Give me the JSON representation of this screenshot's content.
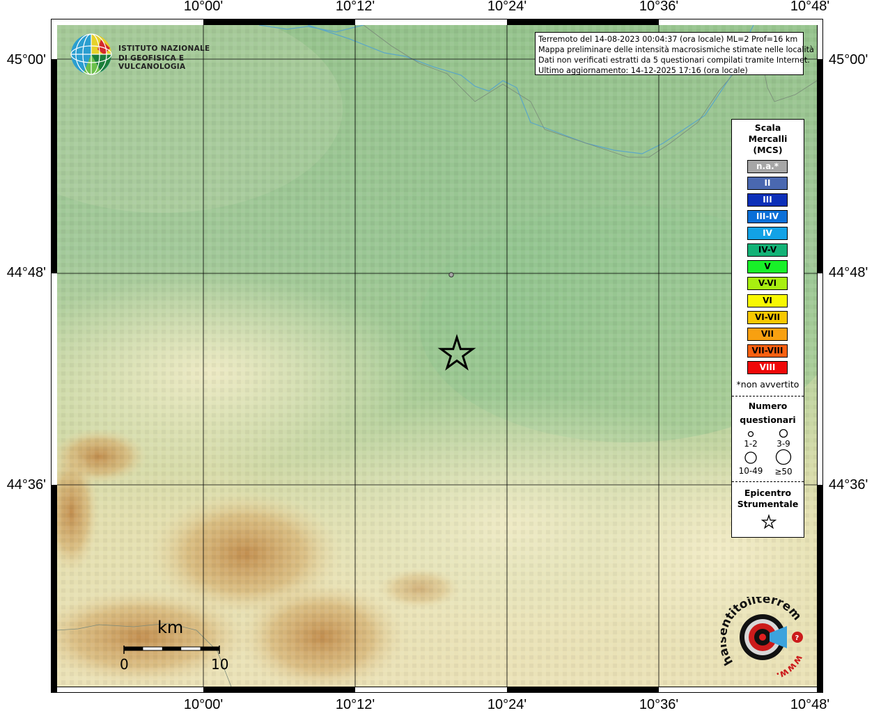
{
  "map": {
    "lon_labels": [
      "10°00'",
      "10°12'",
      "10°24'",
      "10°36'",
      "10°48'"
    ],
    "lat_labels": [
      "45°00'",
      "44°48'",
      "44°36'"
    ]
  },
  "logo_ingv": {
    "line1": "ISTITUTO NAZIONALE",
    "line2": "DI GEOFISICA E VULCANOLOGIA"
  },
  "info_box": {
    "line1": "Terremoto del 14-08-2023 00:04:37 (ora locale) ML=2 Prof=16 km",
    "line2": "Mappa preliminare delle intensità macrosismiche stimate nelle località",
    "line3": "Dati non verificati estratti da 5 questionari compilati tramite Internet.",
    "line4": "Ultimo aggiornamento: 14-12-2025 17:16 (ora locale)"
  },
  "legend": {
    "title1": "Scala",
    "title2": "Mercalli",
    "title3": "(MCS)",
    "classes": [
      {
        "label": "n.a.*",
        "color": "#a6a6a6"
      },
      {
        "label": "II",
        "color": "#4a68b0"
      },
      {
        "label": "III",
        "color": "#0c2fb8"
      },
      {
        "label": "III-IV",
        "color": "#0a6fd8"
      },
      {
        "label": "IV",
        "color": "#12a2e6"
      },
      {
        "label": "IV-V",
        "color": "#12b276"
      },
      {
        "label": "V",
        "color": "#18f028"
      },
      {
        "label": "V-VI",
        "color": "#a8f010"
      },
      {
        "label": "VI",
        "color": "#f8f800"
      },
      {
        "label": "VI-VII",
        "color": "#f8c800"
      },
      {
        "label": "VII",
        "color": "#f8a010"
      },
      {
        "label": "VII-VIII",
        "color": "#f86010"
      },
      {
        "label": "VIII",
        "color": "#f00808"
      }
    ],
    "note": "*non avvertito",
    "count_title1": "Numero",
    "count_title2": "questionari",
    "sizes": [
      "1-2",
      "3-9",
      "10-49",
      "≥50"
    ],
    "epi_title1": "Epicentro",
    "epi_title2": "Strumentale"
  },
  "scalebar": {
    "unit": "km",
    "min": "0",
    "max": "10"
  },
  "hai_logo": {
    "text1": "haisentitoilterremoto.it",
    "text2": "www."
  },
  "colors": {
    "plain": "#a5c99a",
    "hills": "#ece4b6",
    "mountains": "#c9a05a",
    "grid": "#000000",
    "river": "#5aa6c8"
  }
}
